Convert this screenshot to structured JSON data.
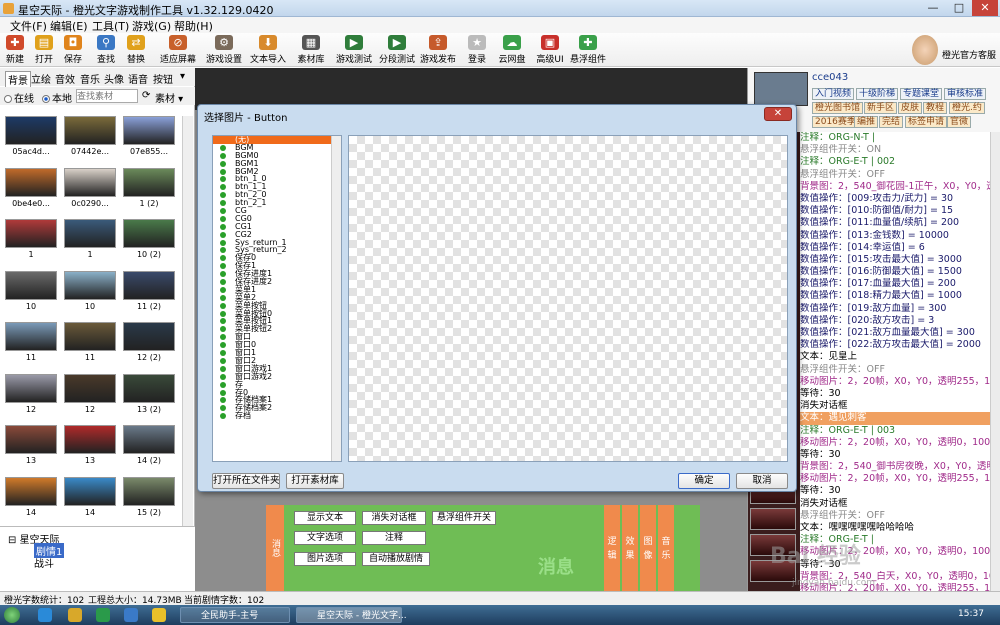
{
  "window": {
    "title": "星空天际 - 橙光文字游戏制作工具 v1.32.129.0420",
    "minimize": "—",
    "maximize": "□",
    "close": "✕"
  },
  "menu": [
    "文件(F)",
    "编辑(E)",
    "工具(T)",
    "游戏(G)",
    "帮助(H)"
  ],
  "toolbar": [
    {
      "label": "新建",
      "color": "#d04a2b",
      "glyph": "✚"
    },
    {
      "label": "打开",
      "color": "#e0a11c",
      "glyph": "▤"
    },
    {
      "label": "保存",
      "color": "#e0841c",
      "glyph": "◘"
    },
    {
      "label": "查找",
      "color": "#3b78c4",
      "glyph": "⚲"
    },
    {
      "label": "替换",
      "color": "#e0a11c",
      "glyph": "⇄"
    },
    {
      "label": "适应屏幕",
      "color": "#c8602b",
      "glyph": "⊘"
    },
    {
      "label": "游戏设置",
      "color": "#7a6a5a",
      "glyph": "⚙"
    },
    {
      "label": "文本导入",
      "color": "#d88a2c",
      "glyph": "⬇"
    },
    {
      "label": "素材库",
      "color": "#555555",
      "glyph": "▦"
    },
    {
      "label": "游戏测试",
      "color": "#2f7d3b",
      "glyph": "▶"
    },
    {
      "label": "分段测试",
      "color": "#2f7d3b",
      "glyph": "▶"
    },
    {
      "label": "游戏发布",
      "color": "#c65a2b",
      "glyph": "⇪"
    },
    {
      "label": "登录",
      "color": "#bbbbbb",
      "glyph": "★"
    },
    {
      "label": "云网盘",
      "color": "#3aa04a",
      "glyph": "☁"
    },
    {
      "label": "高级UI",
      "color": "#c8302b",
      "glyph": "▣"
    },
    {
      "label": "悬浮组件",
      "color": "#3aa04a",
      "glyph": "✚"
    }
  ],
  "logo_caption": "橙光官方客服",
  "left": {
    "tabs": [
      "背景",
      "立绘",
      "音效",
      "音乐",
      "头像",
      "语音",
      "按钮"
    ],
    "online": "在线",
    "local": "本地",
    "search_placeholder": "查找素材",
    "material_label": "素材",
    "thumbs": [
      {
        "cap": "05ac4d...",
        "color": "#1d3a66"
      },
      {
        "cap": "07442e...",
        "color": "#7a6a3a"
      },
      {
        "cap": "07e855...",
        "color": "#8aa0d8"
      },
      {
        "cap": "0be4e0...",
        "color": "#c06a2a"
      },
      {
        "cap": "0c0290...",
        "color": "#d8d0c8"
      },
      {
        "cap": "1 (2)",
        "color": "#6a8a5a"
      },
      {
        "cap": "1",
        "color": "#b03a3a"
      },
      {
        "cap": "1",
        "color": "#3a5a7a"
      },
      {
        "cap": "10 (2)",
        "color": "#4a7a4a"
      },
      {
        "cap": "10",
        "color": "#6a6a6a"
      },
      {
        "cap": "10",
        "color": "#8ab0c8"
      },
      {
        "cap": "11 (2)",
        "color": "#3a4a6a"
      },
      {
        "cap": "11",
        "color": "#7a9ab8"
      },
      {
        "cap": "11",
        "color": "#6a5a3a"
      },
      {
        "cap": "12 (2)",
        "color": "#2a3a4a"
      },
      {
        "cap": "12",
        "color": "#9a9aa8"
      },
      {
        "cap": "12",
        "color": "#4a3a2a"
      },
      {
        "cap": "13 (2)",
        "color": "#3a4a3a"
      },
      {
        "cap": "13",
        "color": "#8a4a3a"
      },
      {
        "cap": "13",
        "color": "#b02a2a"
      },
      {
        "cap": "14 (2)",
        "color": "#6a7a8a"
      },
      {
        "cap": "14",
        "color": "#d07a2a"
      },
      {
        "cap": "14",
        "color": "#3a8ac8"
      },
      {
        "cap": "15 (2)",
        "color": "#7a8a6a"
      }
    ],
    "tree": {
      "root": "星空天际",
      "child1": "剧情1",
      "child2": "战斗"
    }
  },
  "dialog": {
    "title": "选择图片 - Button",
    "close": "✕",
    "items": [
      "(无)",
      "BGM",
      "BGM0",
      "BGM1",
      "BGM2",
      "btn_1_0",
      "btn_1_1",
      "btn_2_0",
      "btn_2_1",
      "CG",
      "CG0",
      "CG1",
      "CG2",
      "Sys_return_1",
      "Sys_return_2",
      "保存0",
      "保存1",
      "保存进度1",
      "保存进度2",
      "菜单1",
      "菜单2",
      "菜单按钮",
      "菜单按钮0",
      "菜单按钮1",
      "菜单按钮2",
      "窗口",
      "窗口0",
      "窗口1",
      "窗口2",
      "窗口游戏1",
      "窗口游戏2",
      "存",
      "存0",
      "存储档案1",
      "存储档案2",
      "存档"
    ],
    "open_folder": "打开所在文件夹",
    "open_library": "打开素材库",
    "ok": "确定",
    "cancel": "取消"
  },
  "bottom": {
    "left_tab": "消息",
    "buttons": [
      "显示文本",
      "消失对话框",
      "悬浮组件开关",
      "文字选项",
      "注释",
      "图片选项",
      "自动播放剧情"
    ],
    "right_tabs": [
      "逻辑",
      "效果",
      "图像",
      "音乐"
    ],
    "big": "消息"
  },
  "right": {
    "username": "cce043",
    "tags": [
      "入门视频",
      "十级阶梯",
      "专题课堂",
      "审核标准",
      "橙光图书馆",
      "新手区",
      "皮肤",
      "教程",
      "橙光.约",
      "2016赛季",
      "编推",
      "完结",
      "标签申请",
      "官微"
    ],
    "script": [
      {
        "t": "注释：ORG-N-T |",
        "c": "#2a7a2a"
      },
      {
        "t": "悬浮组件开关：ON",
        "c": "#888888"
      },
      {
        "t": "注释：ORG-E-T | 002",
        "c": "#2a7a2a"
      },
      {
        "t": "悬浮组件开关：OFF",
        "c": "#888888"
      },
      {
        "t": "背景图：2，540_御花园-1正午，X0，Y0，透明0，1",
        "c": "#a02a8a"
      },
      {
        "t": "数值操作：[009:攻击力/武力] = 30",
        "c": "#1a1a6a"
      },
      {
        "t": "数值操作：[010:防御值/耐力] = 15",
        "c": "#1a1a6a"
      },
      {
        "t": "数值操作：[011:血量值/续航] = 200",
        "c": "#1a1a6a"
      },
      {
        "t": "数值操作：[013:金钱数] = 10000",
        "c": "#1a1a6a"
      },
      {
        "t": "数值操作：[014:幸运值] = 6",
        "c": "#1a1a6a"
      },
      {
        "t": "数值操作：[015:攻击最大值] = 3000",
        "c": "#1a1a6a"
      },
      {
        "t": "数值操作：[016:防御最大值] = 1500",
        "c": "#1a1a6a"
      },
      {
        "t": "数值操作：[017:血量最大值] = 200",
        "c": "#1a1a6a"
      },
      {
        "t": "数值操作：[018:精力最大值] = 1000",
        "c": "#1a1a6a"
      },
      {
        "t": "数值操作：[019:敌方血量] = 300",
        "c": "#1a1a6a"
      },
      {
        "t": "数值操作：[020:敌方攻击] = 3",
        "c": "#1a1a6a"
      },
      {
        "t": "数值操作：[021:敌方血量最大值] = 300",
        "c": "#1a1a6a"
      },
      {
        "t": "数值操作：[022:敌方攻击最大值] = 2000",
        "c": "#1a1a6a"
      },
      {
        "t": "文本：见皇上",
        "c": "#000000"
      },
      {
        "t": "悬浮组件开关：OFF",
        "c": "#888888"
      },
      {
        "t": "移动图片：2，20帧，X0，Y0，透明255，100%，100",
        "c": "#a02a8a"
      },
      {
        "t": "等待：30",
        "c": "#000000"
      },
      {
        "t": "消失对话框",
        "c": "#000000"
      },
      {
        "t": "文本：遇见刺客",
        "c": "#ffffff",
        "bg": "#f0a060"
      },
      {
        "t": "注释：ORG-E-T | 003",
        "c": "#2a7a2a"
      },
      {
        "t": "移动图片：2，20帧，X0，Y0，透明0，100%，100%",
        "c": "#a02a8a"
      },
      {
        "t": "等待：30",
        "c": "#000000"
      },
      {
        "t": "背景图：2，540_御书房夜晚，X0，Y0，透明0，100",
        "c": "#a02a8a"
      },
      {
        "t": "移动图片：2，20帧，X0，Y0，透明255，100%，100",
        "c": "#a02a8a"
      },
      {
        "t": "等待：30",
        "c": "#000000"
      },
      {
        "t": "消失对话框",
        "c": "#000000"
      },
      {
        "t": "悬浮组件开关：OFF",
        "c": "#888888"
      },
      {
        "t": "文本：嘿嘿嘿嘿嘿哈哈哈哈",
        "c": "#000000"
      },
      {
        "t": "注释：ORG-E-T |",
        "c": "#2a7a2a"
      },
      {
        "t": "移动图片：2，20帧，X0，Y0，透明0，100%，100%",
        "c": "#a02a8a"
      },
      {
        "t": "等待：30",
        "c": "#000000"
      },
      {
        "t": "背景图：2，540_白天，X0，Y0，透明0，100",
        "c": "#a02a8a"
      },
      {
        "t": "移动图片：2，20帧，X0，Y0，透明255，100%，100",
        "c": "#a02a8a"
      }
    ]
  },
  "status": {
    "chars": "橙光字数统计：102",
    "size": "工程总大小：14.73MB",
    "current": "当前剧情字数：102"
  },
  "taskbar": {
    "task1": "全民助手-主号",
    "task2": "星空天际 - 橙光文字...",
    "clock": "15:37"
  },
  "watermark": {
    "main": "Bai 经验",
    "sub": "jingyan.baidu.com"
  }
}
